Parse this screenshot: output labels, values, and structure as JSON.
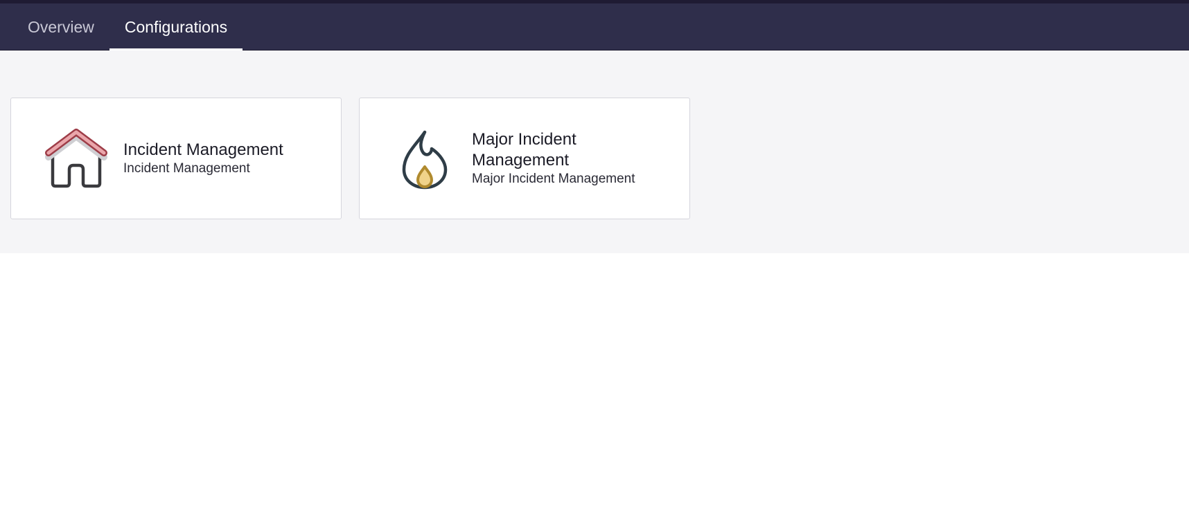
{
  "tabs": [
    {
      "label": "Overview",
      "active": false
    },
    {
      "label": "Configurations",
      "active": true
    }
  ],
  "cards": [
    {
      "icon": "home-icon",
      "title": "Incident Management",
      "subtitle": "Incident Management"
    },
    {
      "icon": "flame-icon",
      "title": "Major Incident Management",
      "subtitle": "Major Incident Management"
    }
  ],
  "colors": {
    "header_bg": "#2f2e4b",
    "content_bg": "#f5f5f7",
    "house_roof": "#e8a3a8",
    "flame_inner": "#f0d38a"
  }
}
